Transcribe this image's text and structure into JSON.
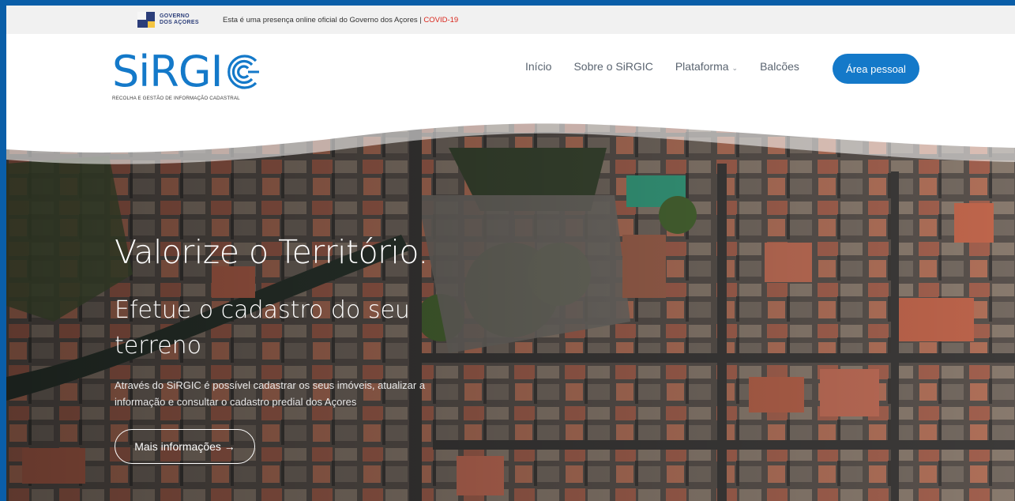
{
  "gov_bar": {
    "logo_line1": "GOVERNO",
    "logo_line2": "DOS AÇORES",
    "message": "Esta é uma presença online oficial do Governo dos Açores | ",
    "covid_link": "COVID-19"
  },
  "header": {
    "logo_text": "SiRGI",
    "logo_tagline": "RECOLHA E GESTÃO DE INFORMAÇÃO CADASTRAL",
    "nav": [
      {
        "label": "Início"
      },
      {
        "label": "Sobre o SiRGIC"
      },
      {
        "label": "Plataforma"
      },
      {
        "label": "Balcões"
      }
    ],
    "area_button": "Área pessoal"
  },
  "hero": {
    "title": "Valorize o Território.",
    "subtitle": "Efetue o cadastro do seu terreno",
    "paragraph": "Através do SiRGIC é possível cadastrar os seus imóveis, atualizar a informação e consultar o cadastro predial dos Açores",
    "button": "Mais informações →"
  },
  "colors": {
    "brand_blue": "#1479c9",
    "covid_red": "#d9261c"
  }
}
